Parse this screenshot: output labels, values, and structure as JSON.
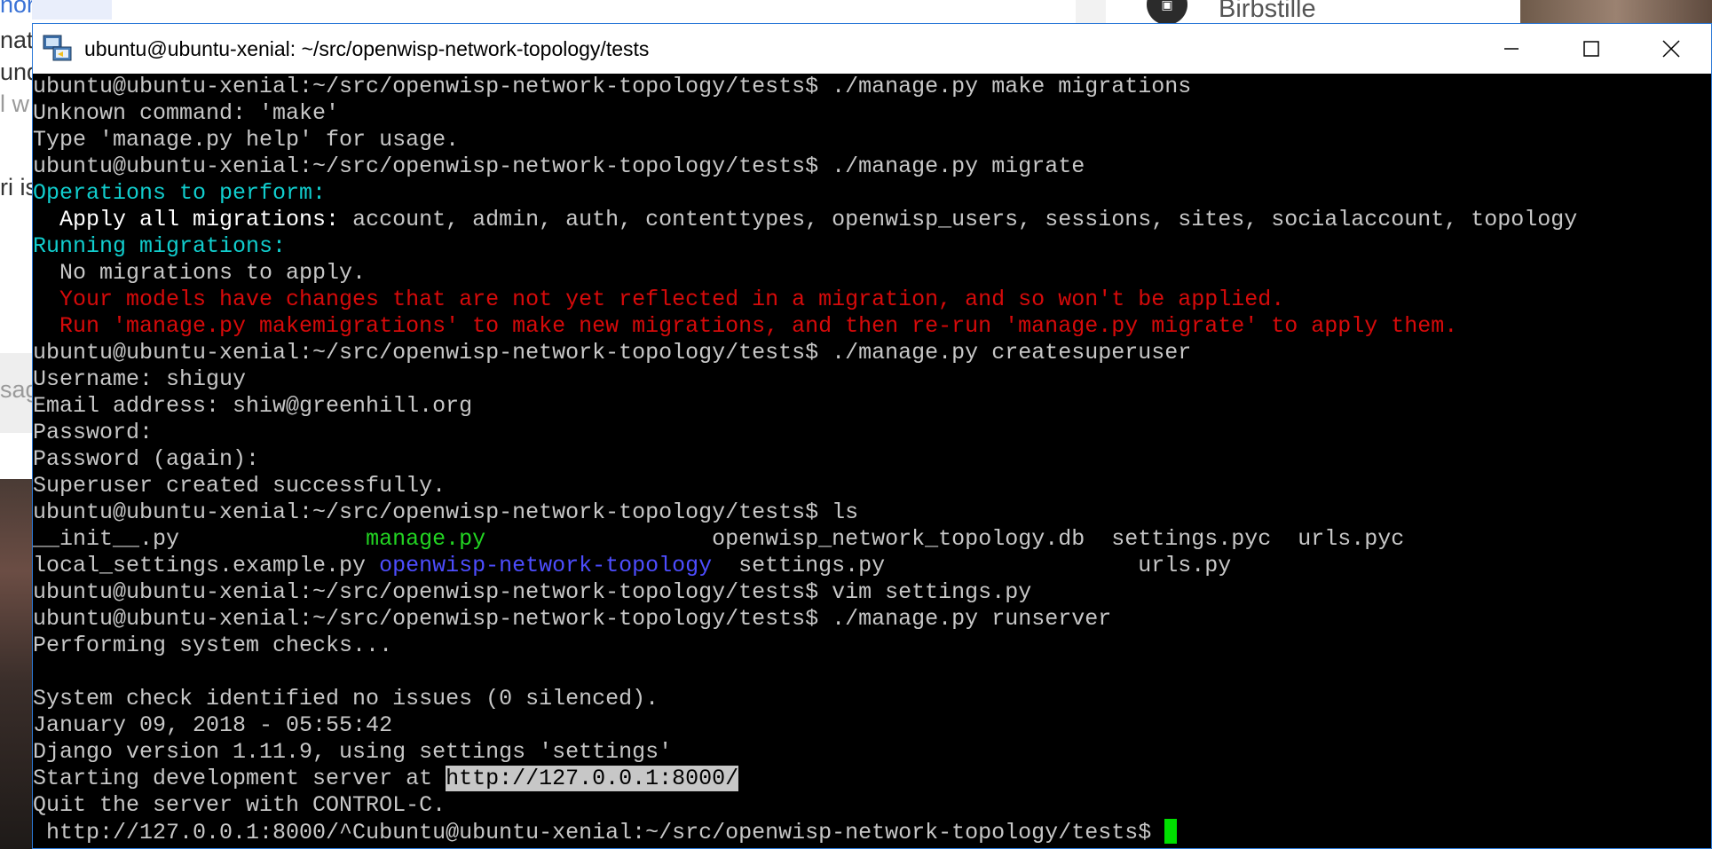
{
  "background": {
    "fragments": [
      {
        "text": "nori is wife",
        "style": "link"
      },
      {
        "text": "nat",
        "style": "normal"
      },
      {
        "text": "und",
        "style": "normal"
      },
      {
        "text": "l w",
        "style": "muted"
      },
      {
        "text": "ri is",
        "style": "normal"
      },
      {
        "text": "sag",
        "style": "muted"
      }
    ],
    "user_name": "Birbstille"
  },
  "window": {
    "title": "ubuntu@ubuntu-xenial: ~/src/openwisp-network-topology/tests"
  },
  "terminal": {
    "prompt": "ubuntu@ubuntu-xenial:~/src/openwisp-network-topology/tests$",
    "cmd1": " ./manage.py make migrations",
    "err1": "Unknown command: 'make'",
    "err2": "Type 'manage.py help' for usage.",
    "cmd2": " ./manage.py migrate",
    "ops_header": "Operations to perform:",
    "apply_label": "  Apply all migrations:",
    "apply_apps": " account, admin, auth, contenttypes, openwisp_users, sessions, sites, socialaccount, topology",
    "running_header": "Running migrations:",
    "no_migrations": "  No migrations to apply.",
    "warn1": "  Your models have changes that are not yet reflected in a migration, and so won't be applied.",
    "warn2": "  Run 'manage.py makemigrations' to make new migrations, and then re-run 'manage.py migrate' to apply them.",
    "cmd3": " ./manage.py createsuperuser",
    "username": "Username: shiguy",
    "email": "Email address: shiw@greenhill.org",
    "password": "Password:",
    "password_again": "Password (again):",
    "superuser_created": "Superuser created successfully.",
    "cmd4": " ls",
    "ls_row1": {
      "c1": "__init__.py              ",
      "c2": "manage.py                 ",
      "c3": "openwisp_network_topology.db  ",
      "c4": "settings.pyc  ",
      "c5": "urls.pyc"
    },
    "ls_row2": {
      "c1": "local_settings.example.py ",
      "c2": "openwisp-network-topology ",
      "c3": " settings.py                   ",
      "c4": "urls.py",
      "c5": ""
    },
    "cmd5": " vim settings.py",
    "cmd6": " ./manage.py runserver",
    "checks": "Performing system checks...",
    "blank": "",
    "check_result": "System check identified no issues (0 silenced).",
    "date": "January 09, 2018 - 05:55:42",
    "django_version": "Django version 1.11.9, using settings 'settings'",
    "starting_prefix": "Starting development server at ",
    "server_url": "http://127.0.0.1:8000/",
    "quit_msg": "Quit the server with CONTROL-C.",
    "last_prefix": " http://127.0.0.1:8000/^C"
  }
}
